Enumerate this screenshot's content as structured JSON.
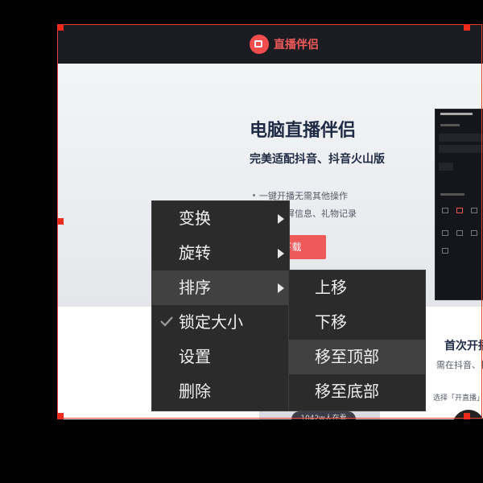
{
  "page": {
    "brand": "直播伴侣",
    "hero_title": "电脑直播伴侣",
    "hero_subtitle": "完美适配抖音、抖音火山版",
    "features": [
      "一键开播无需其他操作",
      "展现公屏信息、礼物记录"
    ],
    "download_button": "下载",
    "first_title": "首次开播",
    "first_line": "需在抖音、抖音火",
    "first_line2": "选择「开直播」功",
    "bottom_pill": "1042w人在看"
  },
  "context_menu": {
    "items": [
      {
        "label": "变换",
        "has_submenu": true
      },
      {
        "label": "旋转",
        "has_submenu": true
      },
      {
        "label": "排序",
        "has_submenu": true,
        "highlighted": true
      },
      {
        "label": "锁定大小",
        "checked": true
      },
      {
        "label": "设置"
      },
      {
        "label": "删除"
      }
    ]
  },
  "submenu": {
    "items": [
      {
        "label": "上移"
      },
      {
        "label": "下移"
      },
      {
        "label": "移至顶部",
        "highlighted": true
      },
      {
        "label": "移至底部"
      }
    ]
  },
  "colors": {
    "accent": "#ee2a1a",
    "menu_bg": "#2b2b2b",
    "menu_highlight": "#414141",
    "brand_red": "#f05a5a"
  }
}
